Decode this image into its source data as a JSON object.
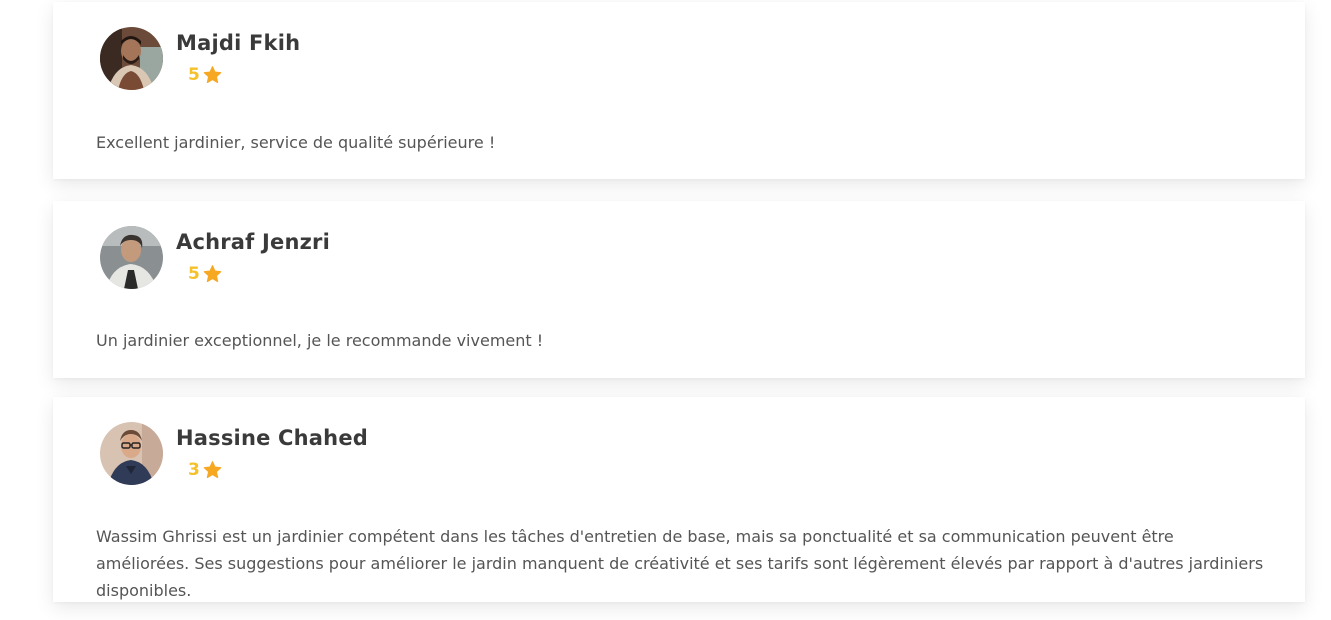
{
  "colors": {
    "name_text": "#3a3a3a",
    "rating_value": "#f4c12b",
    "star": "#f7a823",
    "comment_text": "#555555",
    "card_background": "#ffffff"
  },
  "reviews": [
    {
      "name": "Majdi Fkih",
      "rating": "5",
      "icon": "star-icon",
      "comment": "Excellent jardinier, service de qualité supérieure !"
    },
    {
      "name": "Achraf Jenzri",
      "rating": "5",
      "icon": "star-icon",
      "comment": "Un jardinier exceptionnel, je le recommande vivement !"
    },
    {
      "name": "Hassine Chahed",
      "rating": "3",
      "icon": "star-icon",
      "comment": "Wassim Ghrissi est un jardinier compétent dans les tâches d'entretien de base, mais sa ponctualité et sa communication peuvent être améliorées. Ses suggestions pour améliorer le jardin manquent de créativité et ses tarifs sont légèrement élevés par rapport à d'autres jardiniers disponibles."
    }
  ]
}
